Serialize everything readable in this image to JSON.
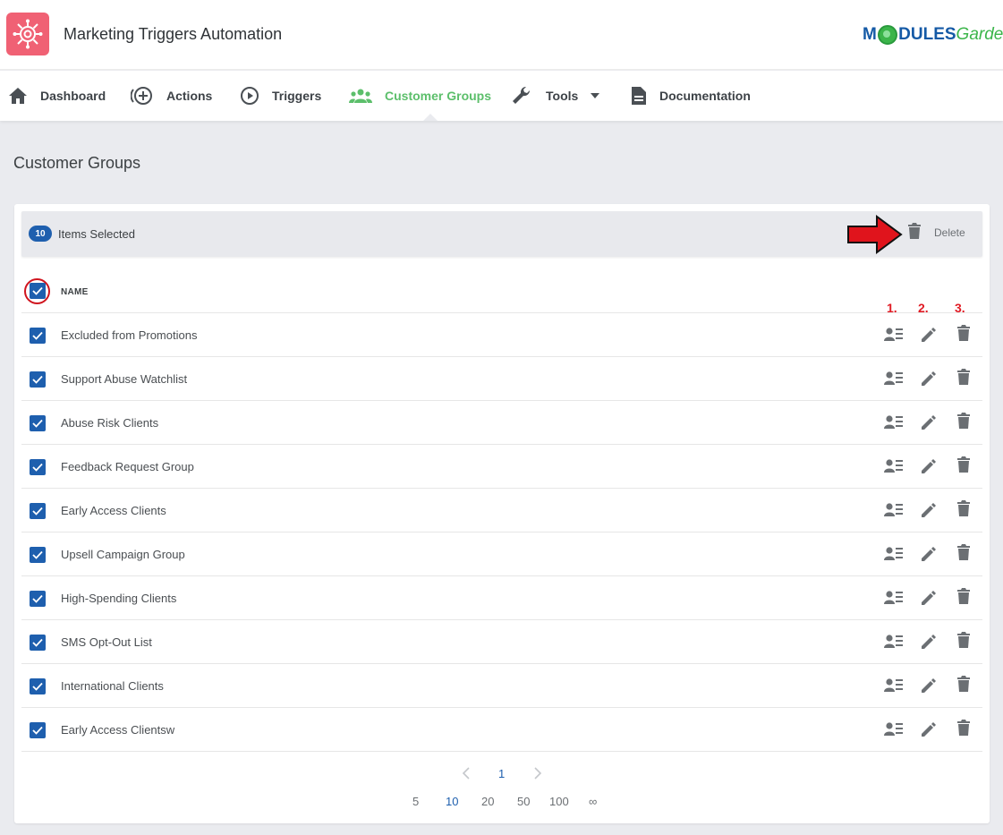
{
  "app": {
    "title": "Marketing Triggers Automation",
    "brand": {
      "part1": "M",
      "part2": "DULES",
      "part3": "Garden"
    }
  },
  "nav": {
    "items": [
      {
        "label": "Dashboard",
        "icon": "home-icon"
      },
      {
        "label": "Actions",
        "icon": "add-circle-icon"
      },
      {
        "label": "Triggers",
        "icon": "play-circle-icon"
      },
      {
        "label": "Customer Groups",
        "icon": "group-icon",
        "active": true
      },
      {
        "label": "Tools",
        "icon": "wrench-icon"
      },
      {
        "label": "Documentation",
        "icon": "document-icon"
      }
    ]
  },
  "page": {
    "title": "Customer Groups"
  },
  "selection": {
    "count": "10",
    "text": "Items Selected",
    "delete_label": "Delete"
  },
  "table": {
    "header_name": "NAME",
    "annotations": [
      "1.",
      "2.",
      "3."
    ],
    "rows": [
      "Excluded from Promotions",
      "Support Abuse Watchlist",
      "Abuse Risk Clients",
      "Feedback Request Group",
      "Early Access Clients",
      "Upsell Campaign Group",
      "High-Spending Clients",
      "SMS Opt-Out List",
      "International Clients",
      "Early Access Clientsw"
    ]
  },
  "pagination": {
    "current": "1",
    "per_page": [
      "5",
      "10",
      "20",
      "50",
      "100",
      "∞"
    ],
    "per_page_active": "10"
  },
  "colors": {
    "accent": "#5cbf6b",
    "primary": "#1e5fae",
    "annotation": "#e01b24"
  }
}
